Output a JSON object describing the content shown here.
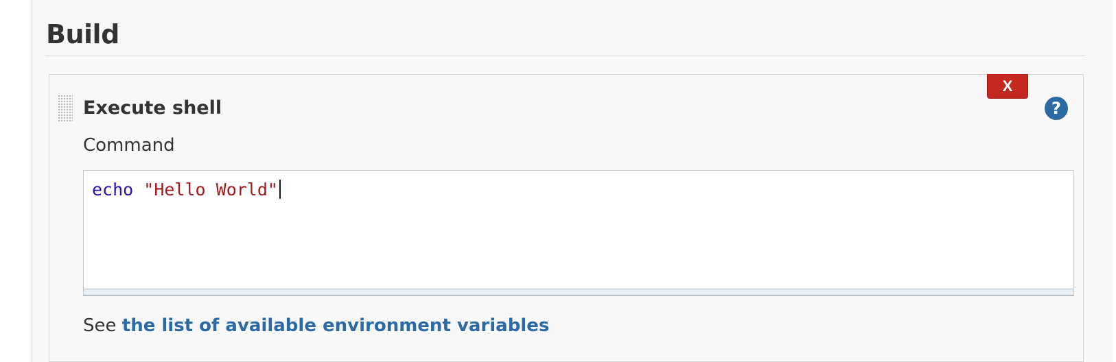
{
  "section": {
    "title": "Build"
  },
  "step": {
    "title": "Execute shell",
    "delete_label": "X",
    "help_label": "?",
    "command": {
      "label": "Command",
      "code_keyword": "echo",
      "code_space": " ",
      "code_string": "\"Hello World\""
    },
    "env_hint": {
      "prefix": "See ",
      "link_text": "the list of available environment variables"
    }
  },
  "colors": {
    "delete_button": "#c4291f",
    "help_icon": "#2b6aa3",
    "link": "#2b6aa3",
    "code_keyword": "#2a13a8",
    "code_string": "#a41a1a"
  },
  "icons": {
    "help": "question-circle-icon",
    "drag": "drag-handle-icon"
  }
}
